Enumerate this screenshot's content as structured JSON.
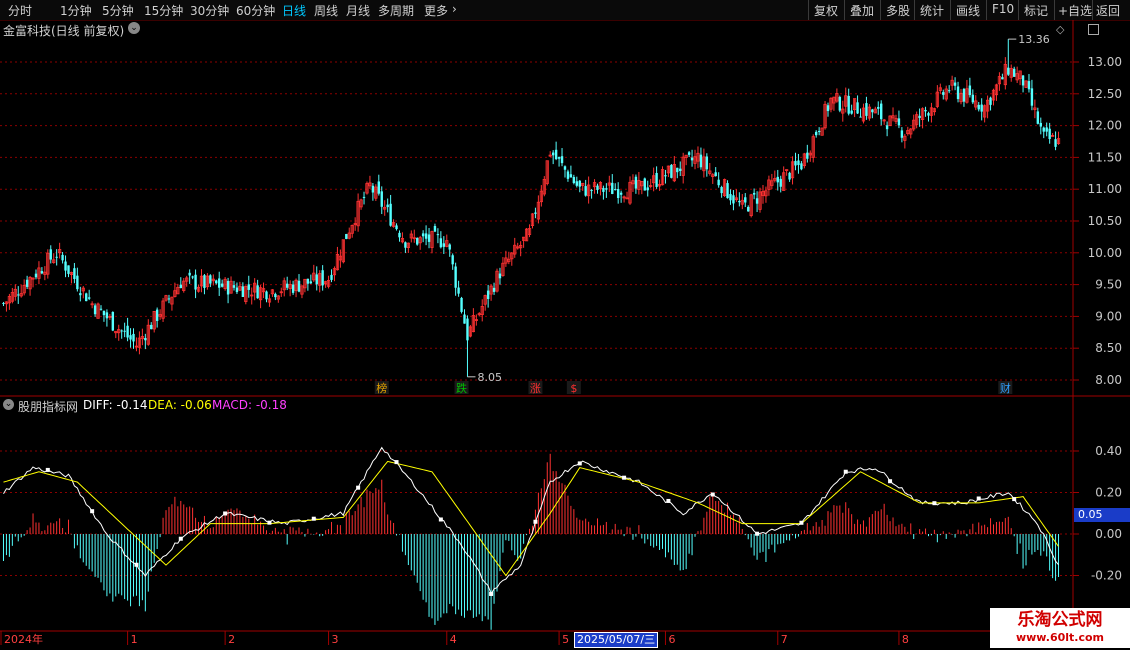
{
  "toolbar": {
    "periods": [
      "分时",
      "1分钟",
      "5分钟",
      "15分钟",
      "30分钟",
      "60分钟",
      "日线",
      "周线",
      "月线",
      "多周期",
      "更多"
    ],
    "active_period": "日线",
    "buttons": [
      "复权",
      "叠加",
      "多股",
      "统计",
      "画线",
      "F10",
      "标记",
      "+自选",
      "返回"
    ]
  },
  "main": {
    "title": "金富科技(日线 前复权)",
    "y_ticks": [
      "13.00",
      "12.50",
      "12.00",
      "11.50",
      "11.00",
      "10.50",
      "10.00",
      "9.50",
      "9.00",
      "8.50",
      "8.00"
    ],
    "high_label": "13.36",
    "low_label": "8.05",
    "markers": [
      {
        "text": "榜",
        "color": "#e0a000"
      },
      {
        "text": "跌",
        "color": "#00c000"
      },
      {
        "text": "涨",
        "color": "#ff3030"
      },
      {
        "text": "$",
        "color": "#ff3030"
      },
      {
        "text": "财",
        "color": "#30a0ff"
      }
    ]
  },
  "indicator": {
    "name": "股朋指标网",
    "diff_label": "DIFF: -0.14",
    "dea_label": "DEA: -0.06",
    "macd_label": "MACD: -0.18",
    "y_ticks": [
      "0.40",
      "0.20",
      "0.00",
      "-0.20"
    ],
    "current_value": "0.05"
  },
  "date_axis": {
    "labels": [
      "2024年",
      "1",
      "2",
      "3",
      "4",
      "5",
      "6",
      "7",
      "8"
    ],
    "cursor_date": "2025/05/07/三"
  },
  "watermark": {
    "title": "乐淘公式网",
    "url": "www.60lt.com"
  },
  "colors": {
    "up": "#ff3232",
    "down": "#54ffff",
    "diff": "#ffffff",
    "dea": "#ffff00",
    "grid": "#8b0000"
  },
  "chart_data": [
    {
      "type": "candlestick",
      "title": "金富科技(日线 前复权)",
      "ylim": [
        8.0,
        13.5
      ],
      "anchors": [
        {
          "i": 0,
          "close": 9.2
        },
        {
          "i": 18,
          "close": 10.0
        },
        {
          "i": 30,
          "close": 9.2
        },
        {
          "i": 45,
          "close": 8.55
        },
        {
          "i": 60,
          "close": 9.55
        },
        {
          "i": 90,
          "close": 9.4
        },
        {
          "i": 110,
          "close": 9.6
        },
        {
          "i": 118,
          "close": 10.5
        },
        {
          "i": 124,
          "close": 11.05
        },
        {
          "i": 136,
          "close": 10.2
        },
        {
          "i": 150,
          "close": 10.2
        },
        {
          "i": 157,
          "close": 8.7
        },
        {
          "i": 168,
          "close": 9.7
        },
        {
          "i": 178,
          "close": 10.3
        },
        {
          "i": 185,
          "close": 11.6
        },
        {
          "i": 195,
          "close": 11.0
        },
        {
          "i": 215,
          "close": 11.0
        },
        {
          "i": 235,
          "close": 11.5
        },
        {
          "i": 250,
          "close": 10.7
        },
        {
          "i": 270,
          "close": 11.4
        },
        {
          "i": 280,
          "close": 12.4
        },
        {
          "i": 295,
          "close": 12.2
        },
        {
          "i": 305,
          "close": 11.9
        },
        {
          "i": 320,
          "close": 12.6
        },
        {
          "i": 332,
          "close": 12.3
        },
        {
          "i": 340,
          "close": 12.9
        },
        {
          "i": 345,
          "close": 12.7
        },
        {
          "i": 352,
          "close": 11.8
        },
        {
          "i": 357,
          "close": 11.75
        }
      ],
      "high": 13.36,
      "low": 8.05
    },
    {
      "type": "macd",
      "series_names": [
        "DIFF",
        "DEA",
        "MACD"
      ],
      "ylim": [
        -0.38,
        0.58
      ],
      "diff_anchors": [
        {
          "i": 0,
          "v": 0.2
        },
        {
          "i": 10,
          "v": 0.32
        },
        {
          "i": 22,
          "v": 0.28
        },
        {
          "i": 35,
          "v": 0.0
        },
        {
          "i": 48,
          "v": -0.2
        },
        {
          "i": 60,
          "v": -0.02
        },
        {
          "i": 75,
          "v": 0.1
        },
        {
          "i": 95,
          "v": 0.05
        },
        {
          "i": 115,
          "v": 0.1
        },
        {
          "i": 128,
          "v": 0.42
        },
        {
          "i": 140,
          "v": 0.22
        },
        {
          "i": 155,
          "v": -0.05
        },
        {
          "i": 165,
          "v": -0.28
        },
        {
          "i": 175,
          "v": -0.15
        },
        {
          "i": 185,
          "v": 0.25
        },
        {
          "i": 195,
          "v": 0.35
        },
        {
          "i": 215,
          "v": 0.25
        },
        {
          "i": 230,
          "v": 0.1
        },
        {
          "i": 240,
          "v": 0.2
        },
        {
          "i": 255,
          "v": 0.0
        },
        {
          "i": 270,
          "v": 0.05
        },
        {
          "i": 285,
          "v": 0.3
        },
        {
          "i": 295,
          "v": 0.32
        },
        {
          "i": 310,
          "v": 0.15
        },
        {
          "i": 325,
          "v": 0.15
        },
        {
          "i": 340,
          "v": 0.2
        },
        {
          "i": 350,
          "v": 0.05
        },
        {
          "i": 357,
          "v": -0.15
        }
      ],
      "dea_anchors": [
        {
          "i": 0,
          "v": 0.25
        },
        {
          "i": 12,
          "v": 0.3
        },
        {
          "i": 25,
          "v": 0.25
        },
        {
          "i": 40,
          "v": 0.05
        },
        {
          "i": 55,
          "v": -0.15
        },
        {
          "i": 70,
          "v": 0.05
        },
        {
          "i": 90,
          "v": 0.05
        },
        {
          "i": 115,
          "v": 0.08
        },
        {
          "i": 130,
          "v": 0.35
        },
        {
          "i": 145,
          "v": 0.3
        },
        {
          "i": 160,
          "v": 0.0
        },
        {
          "i": 170,
          "v": -0.2
        },
        {
          "i": 185,
          "v": 0.1
        },
        {
          "i": 195,
          "v": 0.32
        },
        {
          "i": 215,
          "v": 0.25
        },
        {
          "i": 235,
          "v": 0.15
        },
        {
          "i": 250,
          "v": 0.05
        },
        {
          "i": 270,
          "v": 0.05
        },
        {
          "i": 290,
          "v": 0.3
        },
        {
          "i": 310,
          "v": 0.15
        },
        {
          "i": 330,
          "v": 0.15
        },
        {
          "i": 345,
          "v": 0.18
        },
        {
          "i": 357,
          "v": -0.06
        }
      ]
    }
  ]
}
